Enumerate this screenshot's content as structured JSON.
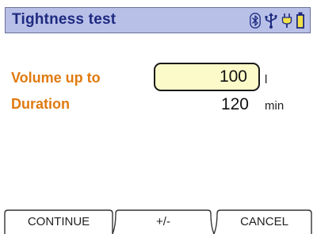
{
  "header": {
    "title": "Tightness test",
    "status_icons": [
      "bluetooth-icon",
      "usb-icon",
      "power-plug-icon",
      "battery-icon"
    ],
    "bar_color": "#b9c0e8",
    "title_color": "#1e2a80"
  },
  "fields": {
    "volume": {
      "label": "Volume up to",
      "value": "100",
      "unit": "l"
    },
    "duration": {
      "label": "Duration",
      "value": "120",
      "unit": "min"
    },
    "label_color": "#e07a10"
  },
  "softkeys": {
    "continue": "CONTINUE",
    "plus_minus": "+/-",
    "cancel": "CANCEL"
  }
}
